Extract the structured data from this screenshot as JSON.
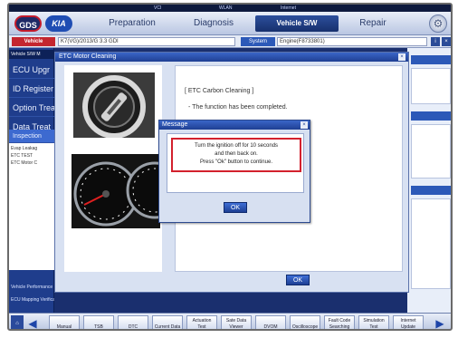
{
  "status_bar": {
    "items": [
      "VCI",
      "WLAN",
      "Internet"
    ]
  },
  "header": {
    "logos": [
      "GDS",
      "KIA"
    ],
    "tabs": [
      {
        "label": "Preparation",
        "active": false
      },
      {
        "label": "Diagnosis",
        "active": false
      },
      {
        "label": "Vehicle S/W Management",
        "active": true
      },
      {
        "label": "Repair",
        "active": false
      }
    ]
  },
  "vehicle_bar": {
    "vehicle_button": "Vehicle",
    "vehicle_value": "K7(VG)/2013/G 3.3 GDI",
    "system_button": "System",
    "system_value": "Engine(F8733801)"
  },
  "sidebar": {
    "title": "Vehicle S/W M",
    "items": [
      {
        "label": "ECU Upgr",
        "selected": false
      },
      {
        "label": "ID Register",
        "selected": false
      },
      {
        "label": "Option Treat",
        "selected": false
      },
      {
        "label": "Data Treat",
        "selected": false
      },
      {
        "label": "Inspection",
        "selected": true
      }
    ],
    "tree": [
      "Evap Leakag",
      "ETC TEST",
      "ETC Motor C"
    ],
    "bottom": [
      "Vehicle Performance",
      "ECU Mapping Verification"
    ]
  },
  "etc_window": {
    "title": "ETC Motor Cleaning",
    "heading": "[ ETC Carbon Cleaning ]",
    "line": "- The function has been completed.",
    "ok_label": "OK"
  },
  "message_dialog": {
    "title": "Message",
    "lines": [
      "Turn the ignition off for 10 seconds",
      "and then back on.",
      "Press \"Ok\" button to continue."
    ],
    "ok_label": "OK"
  },
  "toolbar": {
    "buttons": [
      {
        "top": "",
        "bottom": "Manual"
      },
      {
        "top": "",
        "bottom": "TSB"
      },
      {
        "top": "",
        "bottom": "DTC"
      },
      {
        "top": "",
        "bottom": "Current Data"
      },
      {
        "top": "Actuation",
        "bottom": "Test"
      },
      {
        "top": "Sate Data",
        "bottom": "Viewer"
      },
      {
        "top": "",
        "bottom": "DVOM"
      },
      {
        "top": "",
        "bottom": "Oscilloscope"
      },
      {
        "top": "Fault Code",
        "bottom": "Searching"
      },
      {
        "top": "Simulation",
        "bottom": "Test"
      },
      {
        "top": "Internet",
        "bottom": "Update"
      }
    ]
  },
  "colors": {
    "primary_blue": "#1f3d8c",
    "accent_red": "#d3212d",
    "ok_button": "#1d3f94"
  }
}
